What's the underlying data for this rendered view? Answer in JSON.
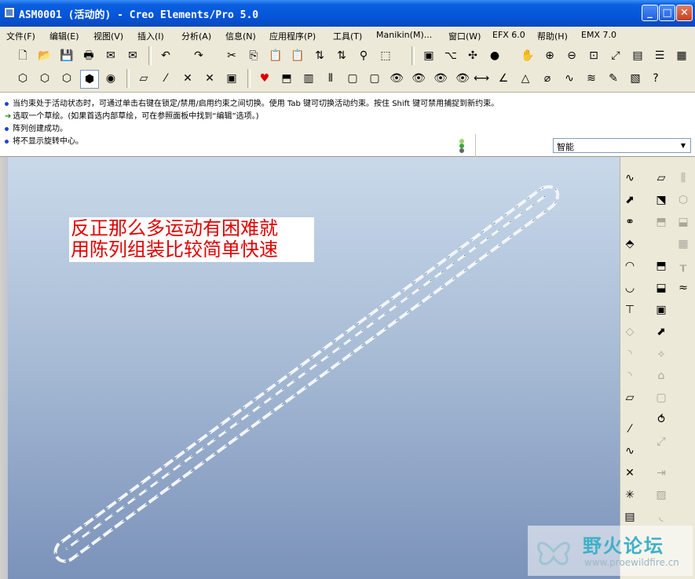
{
  "window": {
    "title": "ASM0001 (活动的) - Creo Elements/Pro 5.0",
    "minimize_glyph": "_",
    "maximize_glyph": "□",
    "close_glyph": "✕"
  },
  "menu": [
    "文件(F)",
    "编辑(E)",
    "视图(V)",
    "插入(I)",
    "分析(A)",
    "信息(N)",
    "应用程序(P)",
    "工具(T)",
    "Manikin(M)...",
    "窗口(W)",
    "EFX 6.0",
    "帮助(H)",
    "EMX 7.0"
  ],
  "toolbar_icons": {
    "row1": [
      "new-file-icon",
      "open-file-icon",
      "save-icon",
      "print-icon",
      "send-mail-icon",
      "mail-recipient-icon",
      "undo-icon",
      "redo-icon",
      "cut-icon",
      "copy-icon",
      "paste-icon",
      "paste-special-icon",
      "regenerate-icon",
      "regen-manager-icon",
      "find-icon",
      "select-box-icon",
      "sketch-view-icon",
      "datum-display-icon",
      "spin-center-icon",
      "shading-icon",
      "pan-icon",
      "zoom-in-icon",
      "zoom-out-icon",
      "refit-icon",
      "reorient-icon",
      "named-views-icon",
      "layers-icon",
      "appearance-icon"
    ],
    "row2": [
      "wireframe-icon",
      "hidden-line-icon",
      "no-hidden-icon",
      "shaded-icon",
      "model-tree-icon",
      "datum-plane-display-icon",
      "datum-axis-display-icon",
      "datum-point-display-icon",
      "csys-display-icon",
      "annotation-display-icon",
      "favorite-icon",
      "assemble-icon",
      "create-component-icon",
      "explode-icon",
      "component-display-icon",
      "cross-section-icon",
      "hide-icon",
      "unhide-icon",
      "show-all-icon",
      "hide-all-icon",
      "measure-distance-icon",
      "measure-angle-icon",
      "measure-area-icon",
      "measure-diameter-icon",
      "curve-analysis-icon",
      "surface-analysis-icon",
      "edit-definition-icon",
      "relations-icon",
      "context-help-icon"
    ]
  },
  "messages": [
    {
      "type": "bullet",
      "text": "当约束处于活动状态时，可通过单击右键在锁定/禁用/启用约束之间切换。使用 Tab 键可切换活动约束。按住 Shift 键可禁用捕捉到新约束。"
    },
    {
      "type": "arrow",
      "text": "选取一个草绘。(如果首选内部草绘，可在参照面板中找到“编辑”选项。)"
    },
    {
      "type": "bullet",
      "text": "阵列创建成功。"
    },
    {
      "type": "bullet",
      "text": "将不显示旋转中心。"
    }
  ],
  "filter": {
    "value": "智能"
  },
  "annotation": {
    "line1": "反正那么多运动有困难就",
    "line2": "用陈列组装比较简单快速"
  },
  "watermark": {
    "title": "野火论坛",
    "url": "www.proewildfire.cn"
  },
  "colors": {
    "titlebar": "#0553d6",
    "annotation_text": "#e00000",
    "viewport_top": "#c9d9ea",
    "viewport_bottom": "#7b92ba"
  }
}
